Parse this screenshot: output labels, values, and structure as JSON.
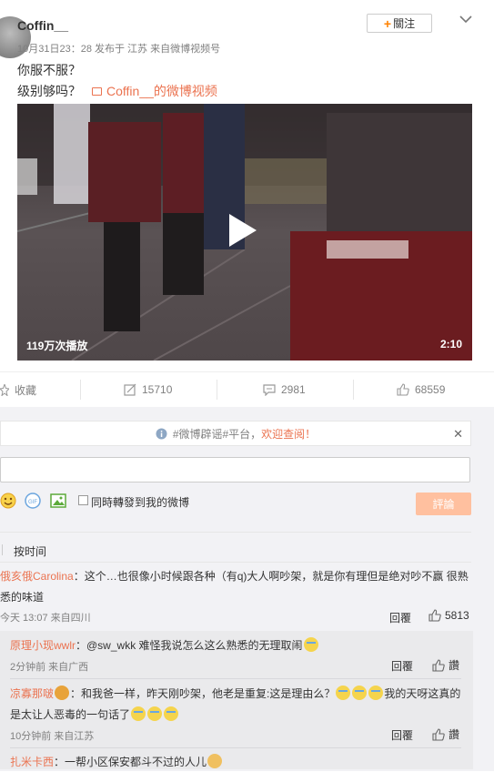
{
  "post": {
    "username": "Coffin__",
    "meta": "10月31日23：28 发布于 江苏 来自微博视频号",
    "line1": "你服不服？",
    "line2": "级别够吗？",
    "video_link": "Coffin__的微博视频",
    "follow_label": "關注",
    "video": {
      "plays": "119万次播放",
      "duration": "2:10"
    }
  },
  "actions": {
    "collect": "收藏",
    "repost": "15710",
    "comment": "2981",
    "like": "68559"
  },
  "composer": {
    "notice_prefix": "#微博辟谣#平台，",
    "notice_link": "欢迎查阅！",
    "sync_label": "同時轉發到我的微博",
    "submit_label": "評論"
  },
  "comments": {
    "sort_label": "按时间",
    "top": {
      "user": "俄亥俄Carolina",
      "text1": "：这个…也很像小时候跟各种（有q)大人啊吵架，就是你有理但是绝对吵不赢 很熟",
      "text2": "悉的味道",
      "time": "今天 13:07 来自四川",
      "reply_label": "回覆",
      "likes": "5813"
    },
    "replies": [
      {
        "user": "原理小现wwlr",
        "text": "：@sw_wkk 难怪我说怎么这么熟悉的无理取闹",
        "time": "2分钟前 来自广西",
        "reply_label": "回覆",
        "like_label": "讚"
      },
      {
        "user": "凉寡那啵",
        "text1": "：和我爸一样，昨天刚吵架，他老是重复:这是理由么？",
        "text1b": "我的天呀这真的",
        "text2": "是太让人恶毒的一句话了",
        "time": "10分钟前 来自江苏",
        "reply_label": "回覆",
        "like_label": "讚"
      },
      {
        "user": "扎米卡西",
        "text": "：一帮小区保安都斗不过的人儿"
      }
    ]
  },
  "colors": {
    "accent": "#eb7350",
    "follow_plus": "#ff8200",
    "submit_bg": "#ffc09f"
  }
}
